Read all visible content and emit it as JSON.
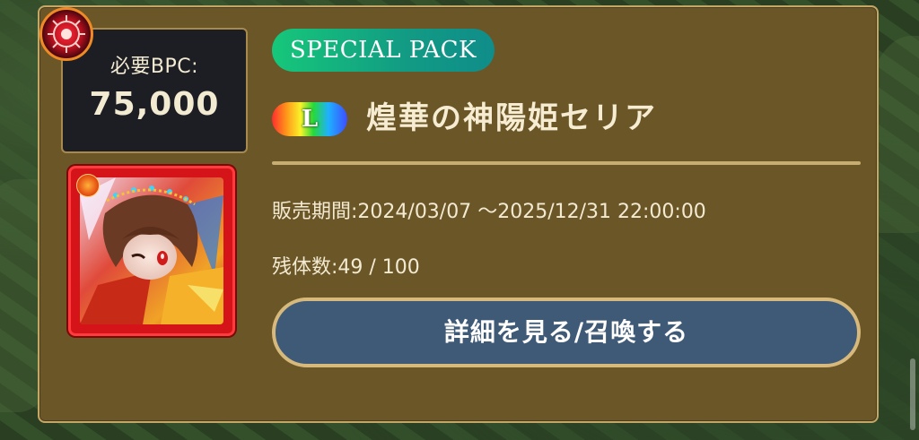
{
  "cost": {
    "label": "必要BPC:",
    "value": "75,000"
  },
  "pack": {
    "label": "SPECIAL PACK"
  },
  "rarity": {
    "letter": "L"
  },
  "character": {
    "name": "煌華の神陽姫セリア"
  },
  "info": {
    "sale_period": "販売期間:2024/03/07 〜2025/12/31 22:00:00",
    "stock": "残体数:49 / 100"
  },
  "action": {
    "detail_button_label": "詳細を見る/召喚する"
  },
  "colors": {
    "card_bg": "#6b5628",
    "card_border": "#c4a766",
    "pack_pill": "#16c77a",
    "button_bg": "#3f5a76",
    "button_border": "#d7b97c",
    "portrait_frame": "#d41418"
  },
  "icons": {
    "badge": "sun-emblem-icon",
    "element": "fire-element-icon"
  }
}
